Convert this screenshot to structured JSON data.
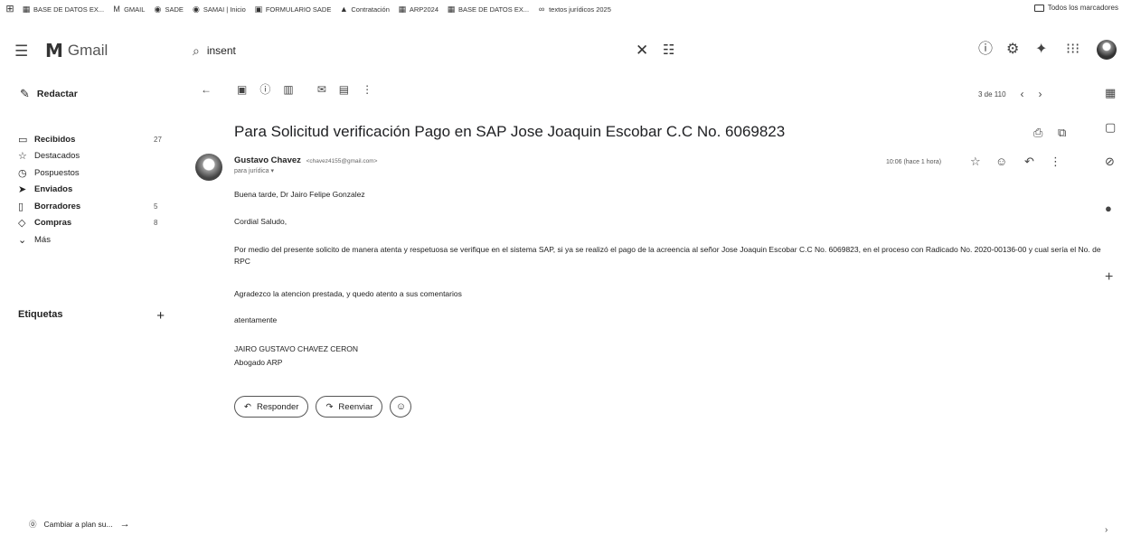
{
  "bookmarks": {
    "items": [
      {
        "label": "BASE DE DATOS EX...",
        "icon": "sheets-icon"
      },
      {
        "label": "GMAIL",
        "icon": "gmail-icon"
      },
      {
        "label": "SADE",
        "icon": "globe-icon"
      },
      {
        "label": "SAMAI | Inicio",
        "icon": "globe-icon"
      },
      {
        "label": "FORMULARIO SADE",
        "icon": "form-icon"
      },
      {
        "label": "Contratación",
        "icon": "drive-icon"
      },
      {
        "label": "ARP2024",
        "icon": "sheets-icon"
      },
      {
        "label": "BASE DE DATOS EX...",
        "icon": "sheets-icon"
      },
      {
        "label": "textos jurídicos 2025",
        "icon": "link-icon"
      }
    ],
    "all_label": "Todos los marcadores"
  },
  "header": {
    "app_name": "Gmail",
    "search_value": "insent"
  },
  "sidebar": {
    "compose_label": "Redactar",
    "items": [
      {
        "label": "Recibidos",
        "count": "27",
        "bold": true,
        "icon": "inbox-icon"
      },
      {
        "label": "Destacados",
        "count": "",
        "bold": false,
        "icon": "star-icon"
      },
      {
        "label": "Pospuestos",
        "count": "",
        "bold": false,
        "icon": "clock-icon"
      },
      {
        "label": "Enviados",
        "count": "",
        "bold": true,
        "icon": "send-icon"
      },
      {
        "label": "Borradores",
        "count": "5",
        "bold": true,
        "icon": "draft-icon"
      },
      {
        "label": "Compras",
        "count": "8",
        "bold": true,
        "icon": "tag-icon"
      },
      {
        "label": "Más",
        "count": "",
        "bold": false,
        "icon": "chevron-down-icon"
      }
    ],
    "labels_title": "Etiquetas",
    "upgrade_label": "Cambiar a plan su..."
  },
  "toolbar": {
    "pager_text": "3 de 110"
  },
  "message": {
    "subject": "Para Solicitud verificación Pago en SAP Jose Joaquin Escobar C.C No. 6069823",
    "sender_name": "Gustavo Chavez",
    "sender_email": "<chavez4155@gmail.com>",
    "recipient": "para jurídica ▾",
    "time": "10:06 (hace 1 hora)",
    "body": {
      "greeting": "Buena tarde, Dr Jairo Felipe Gonzalez",
      "cordial": "Cordial Saludo,",
      "paragraph": "Por medio del presente solicito de manera atenta y respetuosa se verifique en el sistema SAP, si ya se realizó el pago de la acreencia al señor Jose Joaquin Escobar C.C No. 6069823, en el proceso con Radicado No. 2020-00136-00 y cual sería el No. de RPC",
      "thanks": "Agradezco la atencion prestada, y quedo atento a sus comentarios",
      "closing": "atentamente",
      "sig_name": "JAIRO GUSTAVO CHAVEZ CERON",
      "sig_title": "Abogado ARP"
    }
  },
  "actions": {
    "reply_label": "Responder",
    "forward_label": "Reenviar"
  }
}
